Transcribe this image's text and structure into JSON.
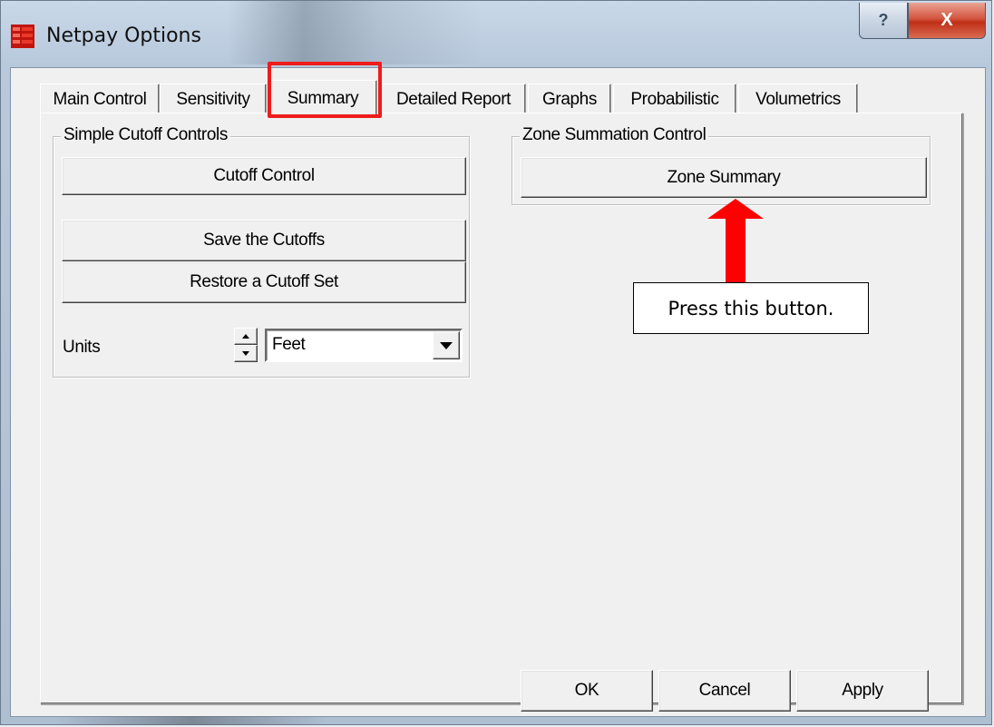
{
  "window": {
    "title": "Netpay Options",
    "help_glyph": "?",
    "close_glyph": "X"
  },
  "tabs": [
    {
      "label": "Main Control",
      "active": false
    },
    {
      "label": "Sensitivity",
      "active": false
    },
    {
      "label": "Summary",
      "active": true
    },
    {
      "label": "Detailed Report",
      "active": false
    },
    {
      "label": "Graphs",
      "active": false
    },
    {
      "label": "Probabilistic",
      "active": false
    },
    {
      "label": "Volumetrics",
      "active": false
    }
  ],
  "simple_cutoff": {
    "legend": "Simple Cutoff Controls",
    "cutoff_control": "Cutoff Control",
    "save": "Save the Cutoffs",
    "restore": "Restore a Cutoff Set",
    "units_label": "Units",
    "units_value": "Feet"
  },
  "zone_summation": {
    "legend": "Zone Summation Control",
    "zone_summary": "Zone Summary"
  },
  "footer": {
    "ok": "OK",
    "cancel": "Cancel",
    "apply": "Apply"
  },
  "annotation": {
    "callout_text": "Press this button.",
    "highlight_color": "#ee1c1c",
    "arrow_color": "#ff0000"
  },
  "icons": {
    "app": "netpay-app-icon",
    "help": "help-icon",
    "close": "close-icon",
    "spin_up": "spin-up-icon",
    "spin_down": "spin-down-icon",
    "dropdown": "dropdown-arrow-icon",
    "arrow": "up-arrow-annotation-icon"
  }
}
